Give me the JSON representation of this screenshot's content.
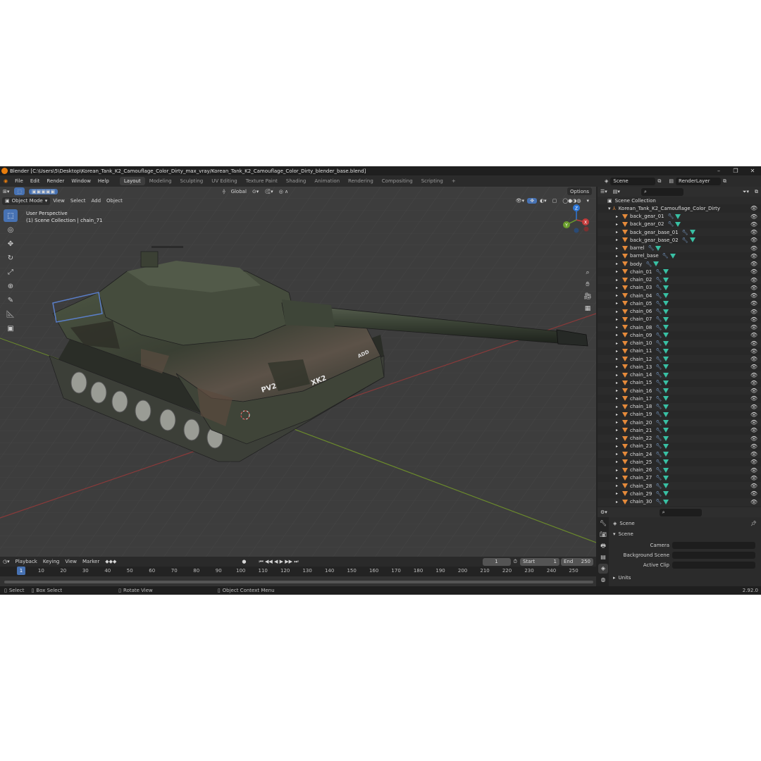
{
  "window": {
    "title": "Blender [C:\\Users\\5\\Desktop\\Korean_Tank_K2_Camouflage_Color_Dirty_max_vray/Korean_Tank_K2_Camouflage_Color_Dirty_blender_base.blend]"
  },
  "menu": [
    "File",
    "Edit",
    "Render",
    "Window",
    "Help"
  ],
  "workspaces": [
    "Layout",
    "Modeling",
    "Sculpting",
    "UV Editing",
    "Texture Paint",
    "Shading",
    "Animation",
    "Rendering",
    "Compositing",
    "Scripting"
  ],
  "scene_selector": {
    "scene": "Scene",
    "view_layer": "RenderLayer"
  },
  "viewport": {
    "mode": "Object Mode",
    "menus": [
      "View",
      "Select",
      "Add",
      "Object"
    ],
    "transform_orientation": "Global",
    "options_label": "Options",
    "info_line1": "User Perspective",
    "info_line2": "(1) Scene Collection | chain_71",
    "gizmo": {
      "x": "X",
      "y": "Y",
      "z": "Z"
    }
  },
  "tank": {
    "hull_label": "PV2",
    "turret_label": "XK2",
    "side_label": "ADD"
  },
  "timeline": {
    "menus": [
      "Playback",
      "Keying",
      "View",
      "Marker"
    ],
    "current_frame": "1",
    "start_label": "Start",
    "start": "1",
    "end_label": "End",
    "end": "250",
    "ticks": [
      "1",
      "10",
      "20",
      "30",
      "40",
      "50",
      "60",
      "70",
      "80",
      "90",
      "100",
      "110",
      "120",
      "130",
      "140",
      "150",
      "160",
      "170",
      "180",
      "190",
      "200",
      "210",
      "220",
      "230",
      "240",
      "250"
    ],
    "frame_marker": "1"
  },
  "statusbar": {
    "select": "Select",
    "box_select": "Box Select",
    "rotate_view": "Rotate View",
    "context_menu": "Object Context Menu",
    "version": "2.92.0"
  },
  "outliner": {
    "root": "Scene Collection",
    "collection": "Korean_Tank_K2_Camouflage_Color_Dirty",
    "items": [
      "back_gear_01",
      "back_gear_02",
      "back_gear_base_01",
      "back_gear_base_02",
      "barrel",
      "barrel_base",
      "body",
      "chain_01",
      "chain_02",
      "chain_03",
      "chain_04",
      "chain_05",
      "chain_06",
      "chain_07",
      "chain_08",
      "chain_09",
      "chain_10",
      "chain_11",
      "chain_12",
      "chain_13",
      "chain_14",
      "chain_15",
      "chain_16",
      "chain_17",
      "chain_18",
      "chain_19",
      "chain_20",
      "chain_21",
      "chain_22",
      "chain_23",
      "chain_24",
      "chain_25",
      "chain_26",
      "chain_27",
      "chain_28",
      "chain_29",
      "chain_30"
    ]
  },
  "properties": {
    "context": "Scene",
    "panel": "Scene",
    "camera_label": "Camera",
    "background_label": "Background Scene",
    "clip_label": "Active Clip",
    "units_label": "Units"
  },
  "colors": {
    "accent": "#4772b3",
    "object_orange": "#e58a3a",
    "mesh_teal": "#39c0a4"
  }
}
